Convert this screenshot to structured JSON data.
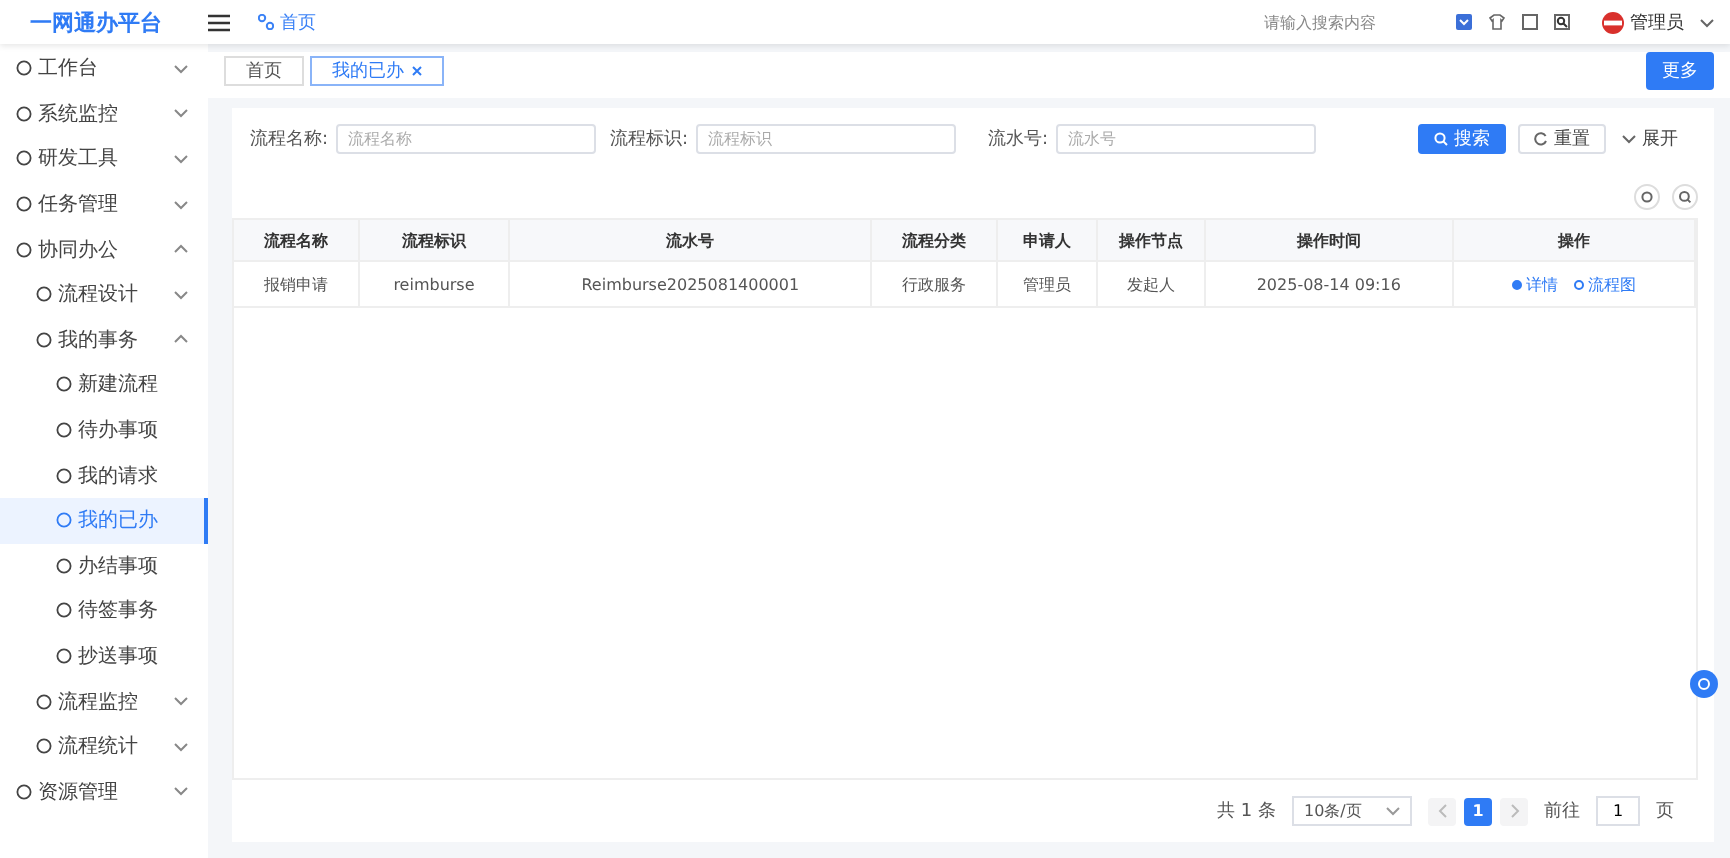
{
  "header": {
    "logo": "一网通办平台",
    "breadcrumb": "首页",
    "search": {
      "placeholder": "请输入搜索内容"
    },
    "user": "管理员"
  },
  "sidebar": {
    "items": [
      {
        "label": "工作台",
        "expanded": false,
        "selected": false
      },
      {
        "label": "系统监控",
        "expanded": false,
        "selected": false
      },
      {
        "label": "研发工具",
        "expanded": false,
        "selected": false
      },
      {
        "label": "任务管理",
        "expanded": false,
        "selected": false
      },
      {
        "label": "协同办公",
        "expanded": true,
        "selected": false,
        "children": [
          {
            "label": "流程设计",
            "expanded": false,
            "selected": false
          },
          {
            "label": "我的事务",
            "expanded": true,
            "selected": false,
            "children": [
              {
                "label": "新建流程",
                "selected": false
              },
              {
                "label": "待办事项",
                "selected": false
              },
              {
                "label": "我的请求",
                "selected": false
              },
              {
                "label": "我的已办",
                "selected": true
              },
              {
                "label": "办结事项",
                "selected": false
              },
              {
                "label": "待签事务",
                "selected": false
              },
              {
                "label": "抄送事项",
                "selected": false
              }
            ]
          },
          {
            "label": "流程监控",
            "expanded": false,
            "selected": false
          },
          {
            "label": "流程统计",
            "expanded": false,
            "selected": false
          }
        ]
      },
      {
        "label": "资源管理",
        "expanded": false,
        "selected": false
      }
    ]
  },
  "tabs": [
    {
      "label": "首页",
      "selected": false,
      "closable": false
    },
    {
      "label": "我的已办",
      "selected": true,
      "closable": true
    }
  ],
  "more_button": "更多",
  "filters": [
    {
      "label": "流程名称:",
      "placeholder": "流程名称"
    },
    {
      "label": "流程标识:",
      "placeholder": "流程标识"
    },
    {
      "label": "流水号:",
      "placeholder": "流水号"
    }
  ],
  "buttons": {
    "search": "搜索",
    "reset": "重置",
    "expand": "展开"
  },
  "table": {
    "columns": [
      "流程名称",
      "流程标识",
      "流水号",
      "流程分类",
      "申请人",
      "操作节点",
      "操作时间",
      "操作"
    ],
    "rows": [
      {
        "cells": [
          "报销申请",
          "reimburse",
          "Reimburse2025081400001",
          "行政服务",
          "管理员",
          "发起人",
          "2025-08-14 09:16"
        ],
        "actions": [
          "详情",
          "流程图"
        ]
      }
    ]
  },
  "pagination": {
    "total": "共 1 条",
    "page_size": "10条/页",
    "pages": [
      {
        "label": "1",
        "selected": true
      }
    ],
    "goto_label": "前往",
    "goto_value": "1",
    "goto_suffix": "页"
  }
}
